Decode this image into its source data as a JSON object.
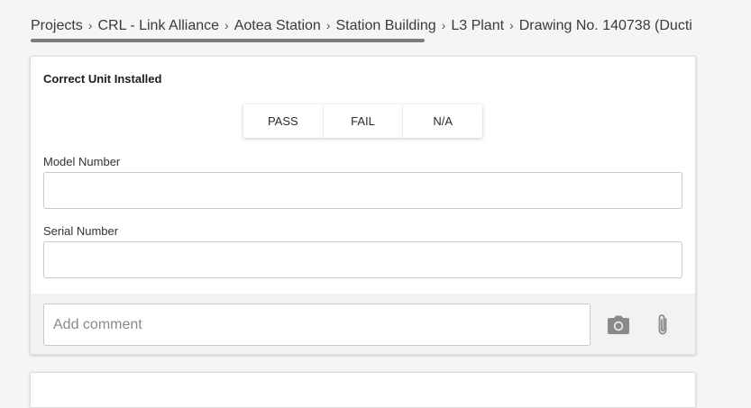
{
  "breadcrumb": {
    "items": [
      "Projects",
      "CRL - Link Alliance",
      "Aotea Station",
      "Station Building",
      "L3 Plant",
      "Drawing No. 140738 (Ducti"
    ],
    "separator": ">"
  },
  "card": {
    "title": "Correct Unit Installed",
    "options": [
      "PASS",
      "FAIL",
      "N/A"
    ],
    "fields": [
      {
        "label": "Model Number",
        "value": ""
      },
      {
        "label": "Serial Number",
        "value": ""
      }
    ],
    "comment": {
      "placeholder": "Add comment",
      "value": ""
    },
    "icons": [
      "camera-icon",
      "paperclip-icon"
    ]
  },
  "colors": {
    "background": "#f5f5f5",
    "card": "#ffffff",
    "comment_bar": "#f2f2f2",
    "icon": "#8a8a8a"
  }
}
